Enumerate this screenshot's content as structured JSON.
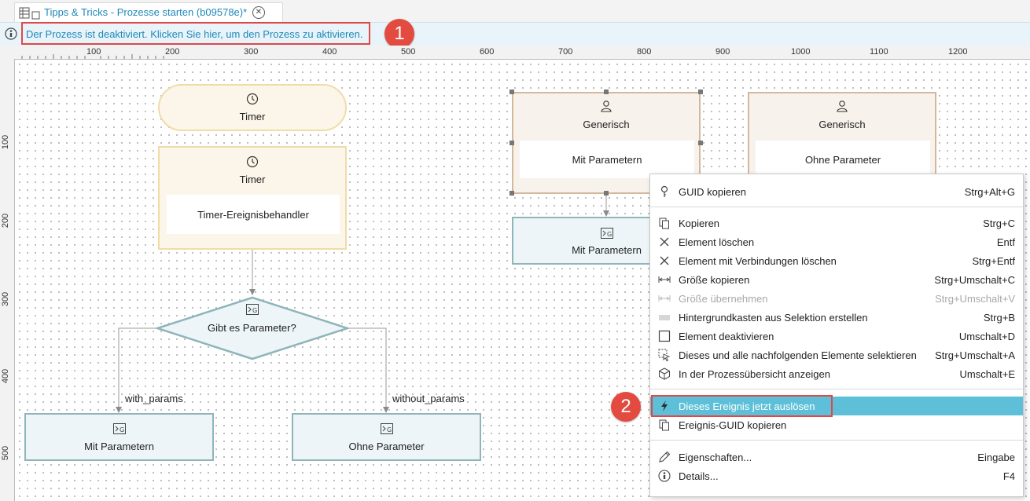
{
  "tab": {
    "title": "Tipps & Tricks - Prozesse starten (b09578e)*",
    "close": "✕"
  },
  "infobar": {
    "message": "Der Prozess ist deaktiviert. Klicken Sie hier, um den Prozess zu aktivieren."
  },
  "badges": {
    "one": "1",
    "two": "2"
  },
  "ruler": {
    "top": [
      "100",
      "200",
      "300",
      "400",
      "500",
      "600",
      "700",
      "800",
      "900",
      "1000",
      "1100",
      "1200"
    ],
    "left": [
      "100",
      "200",
      "300",
      "400",
      "500"
    ]
  },
  "nodes": {
    "timer_start": {
      "label": "Timer"
    },
    "timer_handler": {
      "title": "Timer",
      "inner": "Timer-Ereignisbehandler"
    },
    "gateway": {
      "label": "Gibt es Parameter?"
    },
    "task_with": {
      "label": "Mit Parametern"
    },
    "task_without": {
      "label": "Ohne Parameter"
    },
    "generic_with": {
      "title": "Generisch",
      "inner": "Mit Parametern"
    },
    "generic_without": {
      "title": "Generisch",
      "inner": "Ohne Parameter"
    },
    "task_mid": {
      "label": "Mit Parametern"
    }
  },
  "edges": {
    "with": "with_params",
    "without": "without_params"
  },
  "menu": {
    "items": [
      {
        "label": "GUID kopieren",
        "shortcut": "Strg+Alt+G",
        "icon": "key-icon"
      },
      {
        "label": "Kopieren",
        "shortcut": "Strg+C",
        "icon": "copy-icon"
      },
      {
        "label": "Element löschen",
        "shortcut": "Entf",
        "icon": "close-icon"
      },
      {
        "label": "Element mit Verbindungen löschen",
        "shortcut": "Strg+Entf",
        "icon": "close-icon"
      },
      {
        "label": "Größe kopieren",
        "shortcut": "Strg+Umschalt+C",
        "icon": "size-icon"
      },
      {
        "label": "Größe übernehmen",
        "shortcut": "Strg+Umschalt+V",
        "icon": "size-icon"
      },
      {
        "label": "Hintergrundkasten aus Selektion erstellen",
        "shortcut": "Strg+B",
        "icon": "background-box-icon"
      },
      {
        "label": "Element deaktivieren",
        "shortcut": "Umschalt+D",
        "icon": "checkbox-icon"
      },
      {
        "label": "Dieses und alle nachfolgenden Elemente selektieren",
        "shortcut": "Strg+Umschalt+A",
        "icon": "select-cursor-icon"
      },
      {
        "label": "In der Prozessübersicht anzeigen",
        "shortcut": "Umschalt+E",
        "icon": "cube-icon"
      },
      {
        "label": "Dieses Ereignis jetzt auslösen",
        "shortcut": "",
        "icon": "lightning-icon"
      },
      {
        "label": "Ereignis-GUID kopieren",
        "shortcut": "",
        "icon": "copy-icon"
      },
      {
        "label": "Eigenschaften...",
        "shortcut": "Eingabe",
        "icon": "pencil-icon"
      },
      {
        "label": "Details...",
        "shortcut": "F4",
        "icon": "details-icon"
      }
    ]
  },
  "colors": {
    "accent": "#1e88b8",
    "highlight": "#5ec0d8",
    "badge": "#e34a40",
    "timer_border": "#f0dca8",
    "timer_fill": "#fcf6ea",
    "task_border": "#8fb5ba",
    "task_fill": "#eef5f8",
    "generic_border": "#d3b89c",
    "generic_fill": "#f8f2ec"
  }
}
